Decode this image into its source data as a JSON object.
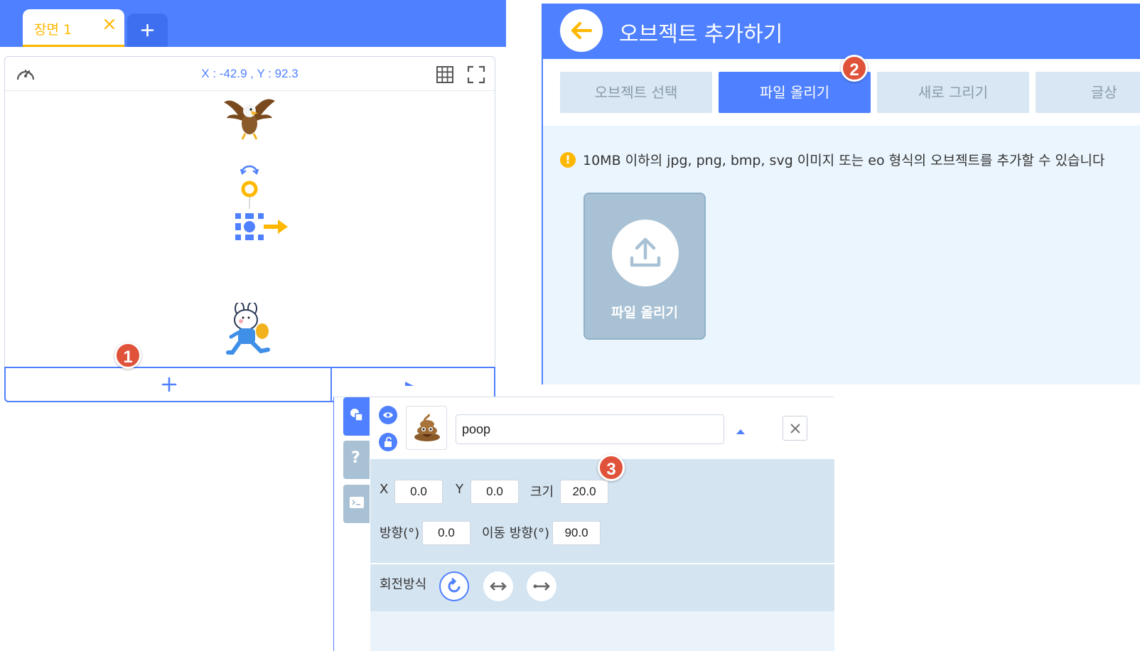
{
  "scene": {
    "tab_label": "장면 1",
    "close_icon": "close-icon",
    "add_icon": "plus-icon"
  },
  "stage": {
    "coordinates": "X : -42.9 , Y : 92.3",
    "icons": [
      "speedometer-icon",
      "grid-icon",
      "fullscreen-icon",
      "play-icon"
    ]
  },
  "badges": {
    "one": "1",
    "two": "2",
    "three": "3"
  },
  "add_object": {
    "title": "오브젝트 추가하기",
    "tabs": [
      {
        "label": "오브젝트 선택",
        "active": false
      },
      {
        "label": "파일 올리기",
        "active": true
      },
      {
        "label": "새로 그리기",
        "active": false
      },
      {
        "label": "글상",
        "active": false
      }
    ],
    "notice_icon": "!",
    "notice": "10MB 이하의 jpg, png, bmp, svg 이미지 또는 eo 형식의 오브젝트를 추가할 수 있습니다",
    "upload_label": "파일 올리기"
  },
  "object": {
    "side_tab_help": "?",
    "name": "poop",
    "x_label": "X",
    "x_value": "0.0",
    "y_label": "Y",
    "y_value": "0.0",
    "size_label": "크기",
    "size_value": "20.0",
    "direction_label": "방향(°)",
    "direction_value": "0.0",
    "move_direction_label": "이동 방향(°)",
    "move_direction_value": "90.0",
    "rotation_label": "회전방식"
  },
  "colors": {
    "accent": "#4f80ff",
    "highlight": "#ffb800",
    "badge": "#e0533a",
    "panel": "#eaf5fd",
    "property_panel": "#d5e4f1"
  }
}
